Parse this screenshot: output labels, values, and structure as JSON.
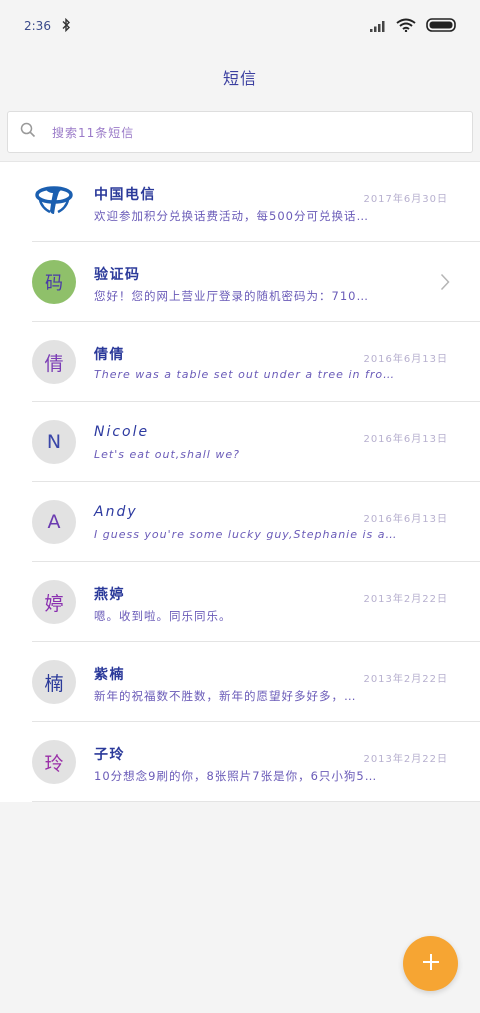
{
  "status_bar": {
    "time": "2:36",
    "bluetooth_icon": "bluetooth-icon",
    "signal_icon": "signal-icon",
    "wifi_icon": "wifi-icon",
    "battery_icon": "battery-icon"
  },
  "header": {
    "title": "短信"
  },
  "search": {
    "icon": "search-icon",
    "placeholder": "搜索11条短信"
  },
  "conversations": [
    {
      "avatar": "",
      "avatar_icon": "china-telecom-logo",
      "name": "中国电信",
      "date": "2017年6月30日",
      "preview": "欢迎参加积分兑换话费活动，每500分可兑换话…"
    },
    {
      "avatar": "码",
      "name": "验证码",
      "date": "",
      "preview": "您好！您的网上营业厅登录的随机密码为：710…",
      "chevron_icon": "chevron-right-icon"
    },
    {
      "avatar": "倩",
      "name": "倩倩",
      "date": "2016年6月13日",
      "preview": "There was a table set out under a tree in front…"
    },
    {
      "avatar": "N",
      "name": "Nicole",
      "date": "2016年6月13日",
      "preview": "Let's eat out,shall we?"
    },
    {
      "avatar": "A",
      "name": "Andy",
      "date": "2016年6月13日",
      "preview": "I guess you're some lucky guy,Stephanie is a ni…"
    },
    {
      "avatar": "婷",
      "name": "燕婷",
      "date": "2013年2月22日",
      "preview": "嗯。收到啦。同乐同乐。"
    },
    {
      "avatar": "楠",
      "name": "紫楠",
      "date": "2013年2月22日",
      "preview": "新年的祝福数不胜数，新年的愿望好多好多，…"
    },
    {
      "avatar": "玲",
      "name": "子玲",
      "date": "2013年2月22日",
      "preview": "10分想念9刷的你，8张照片7张是你，6只小狗5…"
    }
  ],
  "fab": {
    "icon": "plus-icon"
  },
  "colors": {
    "fab": "#f6a533",
    "code_avatar": "#8fc06a",
    "telecom_blue": "#1b5fb0"
  }
}
